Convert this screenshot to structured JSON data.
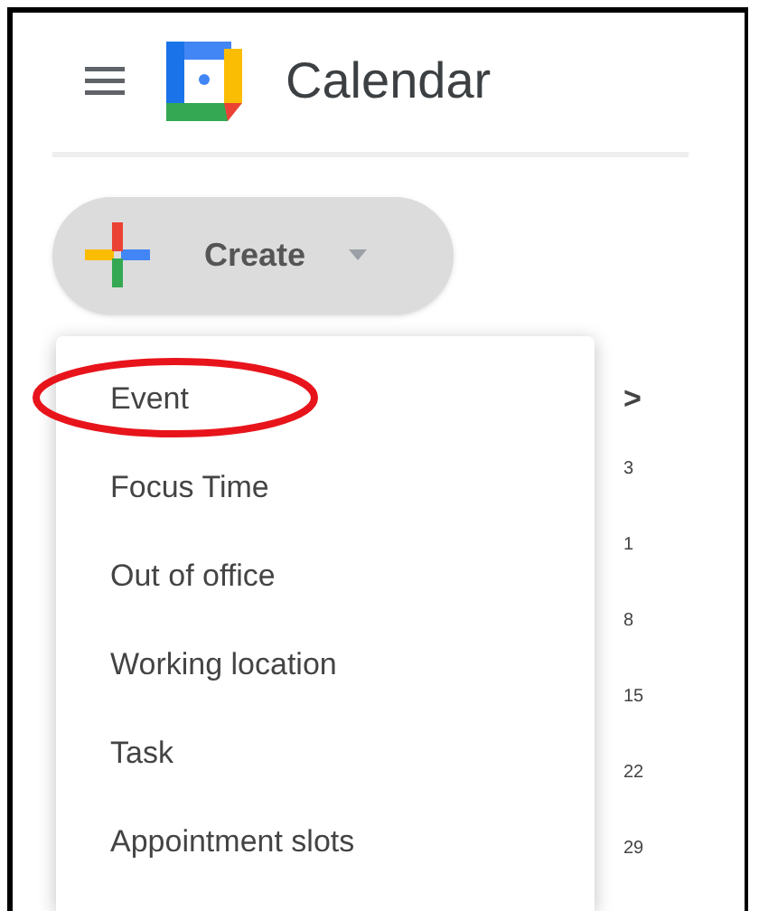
{
  "header": {
    "title": "Calendar"
  },
  "create_button": {
    "label": "Create"
  },
  "create_menu": [
    {
      "label": "Event",
      "circled": true
    },
    {
      "label": "Focus Time",
      "circled": false
    },
    {
      "label": "Out of office",
      "circled": false
    },
    {
      "label": "Working location",
      "circled": false
    },
    {
      "label": "Task",
      "circled": false
    },
    {
      "label": "Appointment slots",
      "circled": false
    }
  ],
  "mini_calendar": {
    "next_label": ">",
    "dates": [
      "3",
      "1",
      "8",
      "15",
      "22",
      "29"
    ]
  }
}
